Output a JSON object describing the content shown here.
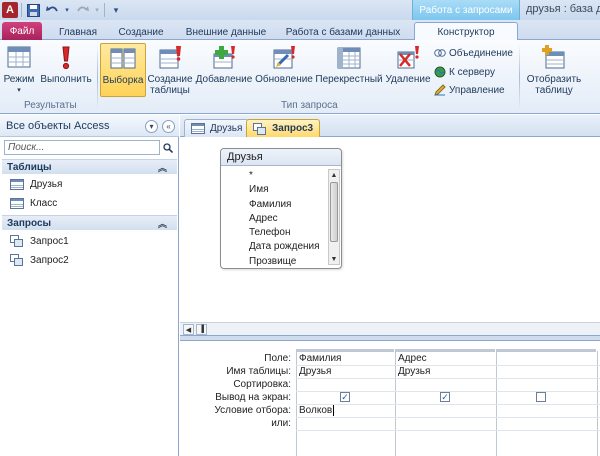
{
  "title_bar": {
    "app_icon_letter": "A",
    "contextual_group": "Работа с запросами",
    "window_title": "друзья : база д"
  },
  "ribbon_tabs": {
    "file": "Файл",
    "items": [
      "Главная",
      "Создание",
      "Внешние данные",
      "Работа с базами данных",
      "Конструктор"
    ]
  },
  "ribbon": {
    "results": {
      "view": "Режим",
      "run": "Выполнить",
      "label": "Результаты"
    },
    "query_type": {
      "select": "Выборка",
      "make_table_1": "Создание",
      "make_table_2": "таблицы",
      "append": "Добавление",
      "update": "Обновление",
      "crosstab": "Перекрестный",
      "delete": "Удаление",
      "union": "Объединение",
      "pass_through": "К серверу",
      "data_definition": "Управление",
      "label": "Тип запроса"
    },
    "show_table_1": "Отобразить",
    "show_table_2": "таблицу"
  },
  "nav_pane": {
    "header": "Все объекты Access",
    "search_placeholder": "Поиск...",
    "groups": [
      {
        "title": "Таблицы",
        "items": [
          "Друзья",
          "Класс"
        ]
      },
      {
        "title": "Запросы",
        "items": [
          "Запрос1",
          "Запрос2"
        ]
      }
    ]
  },
  "doc_tabs": [
    "Друзья",
    "Запрос3"
  ],
  "field_list": {
    "title": "Друзья",
    "fields": [
      "*",
      "Имя",
      "Фамилия",
      "Адрес",
      "Телефон",
      "Дата рождения",
      "Прозвище"
    ]
  },
  "qbe_grid": {
    "row_labels": [
      "Поле:",
      "Имя таблицы:",
      "Сортировка:",
      "Вывод на экран:",
      "Условие отбора:",
      "или:"
    ],
    "columns": [
      {
        "field": "Фамилия",
        "table": "Друзья",
        "sort": "",
        "show": true,
        "criteria": "Волков",
        "or": ""
      },
      {
        "field": "Адрес",
        "table": "Друзья",
        "sort": "",
        "show": true,
        "criteria": "",
        "or": ""
      },
      {
        "field": "",
        "table": "",
        "sort": "",
        "show": false,
        "criteria": "",
        "or": ""
      }
    ]
  },
  "colors": {
    "file_tab": "#b9306a",
    "accent": "#1e395b",
    "selected_button": "#ffd257",
    "contextual": "#7cc6ef"
  }
}
